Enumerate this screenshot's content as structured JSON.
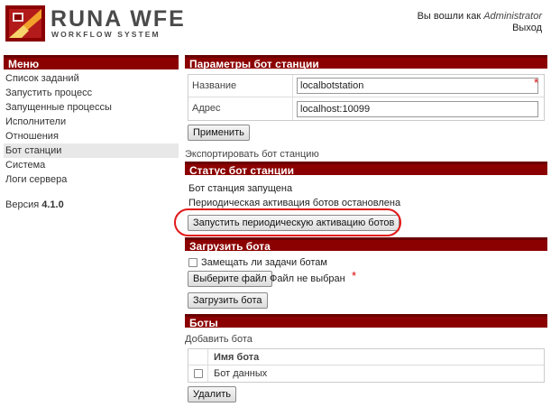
{
  "logo": {
    "title": "RUNA WFE",
    "subtitle": "WORKFLOW SYSTEM"
  },
  "login": {
    "prefix": "Вы вошли как",
    "user": "Administrator",
    "logout": "Выход"
  },
  "sidebar": {
    "title": "Меню",
    "items": [
      {
        "label": "Список заданий"
      },
      {
        "label": "Запустить процесс"
      },
      {
        "label": "Запущенные процессы"
      },
      {
        "label": "Исполнители"
      },
      {
        "label": "Отношения"
      },
      {
        "label": "Бот станции"
      },
      {
        "label": "Система"
      },
      {
        "label": "Логи сервера"
      }
    ],
    "active_index": 5,
    "version_label": "Версия",
    "version_value": "4.1.0"
  },
  "params": {
    "title": "Параметры бот станции",
    "name_label": "Название",
    "name_value": "localbotstation",
    "address_label": "Адрес",
    "address_value": "localhost:10099",
    "apply_button": "Применить",
    "export_link": "Экспортировать бот станцию"
  },
  "status": {
    "title": "Статус бот станции",
    "line1": "Бот станция запущена",
    "line2": "Периодическая активация ботов остановлена",
    "start_button": "Запустить периодическую активацию ботов"
  },
  "upload": {
    "title": "Загрузить бота",
    "replace_label": "Замещать ли задачи ботам",
    "choose_file_button": "Выберите файл",
    "file_status": "Файл не выбран",
    "upload_button": "Загрузить бота"
  },
  "bots": {
    "title": "Боты",
    "add_link": "Добавить бота",
    "column_name": "Имя бота",
    "rows": [
      {
        "name": "Бот данных"
      }
    ],
    "delete_button": "Удалить"
  },
  "colors": {
    "header_bar": "#8b0000",
    "highlight_circle": "#e21818",
    "required_star": "#dd0000"
  }
}
